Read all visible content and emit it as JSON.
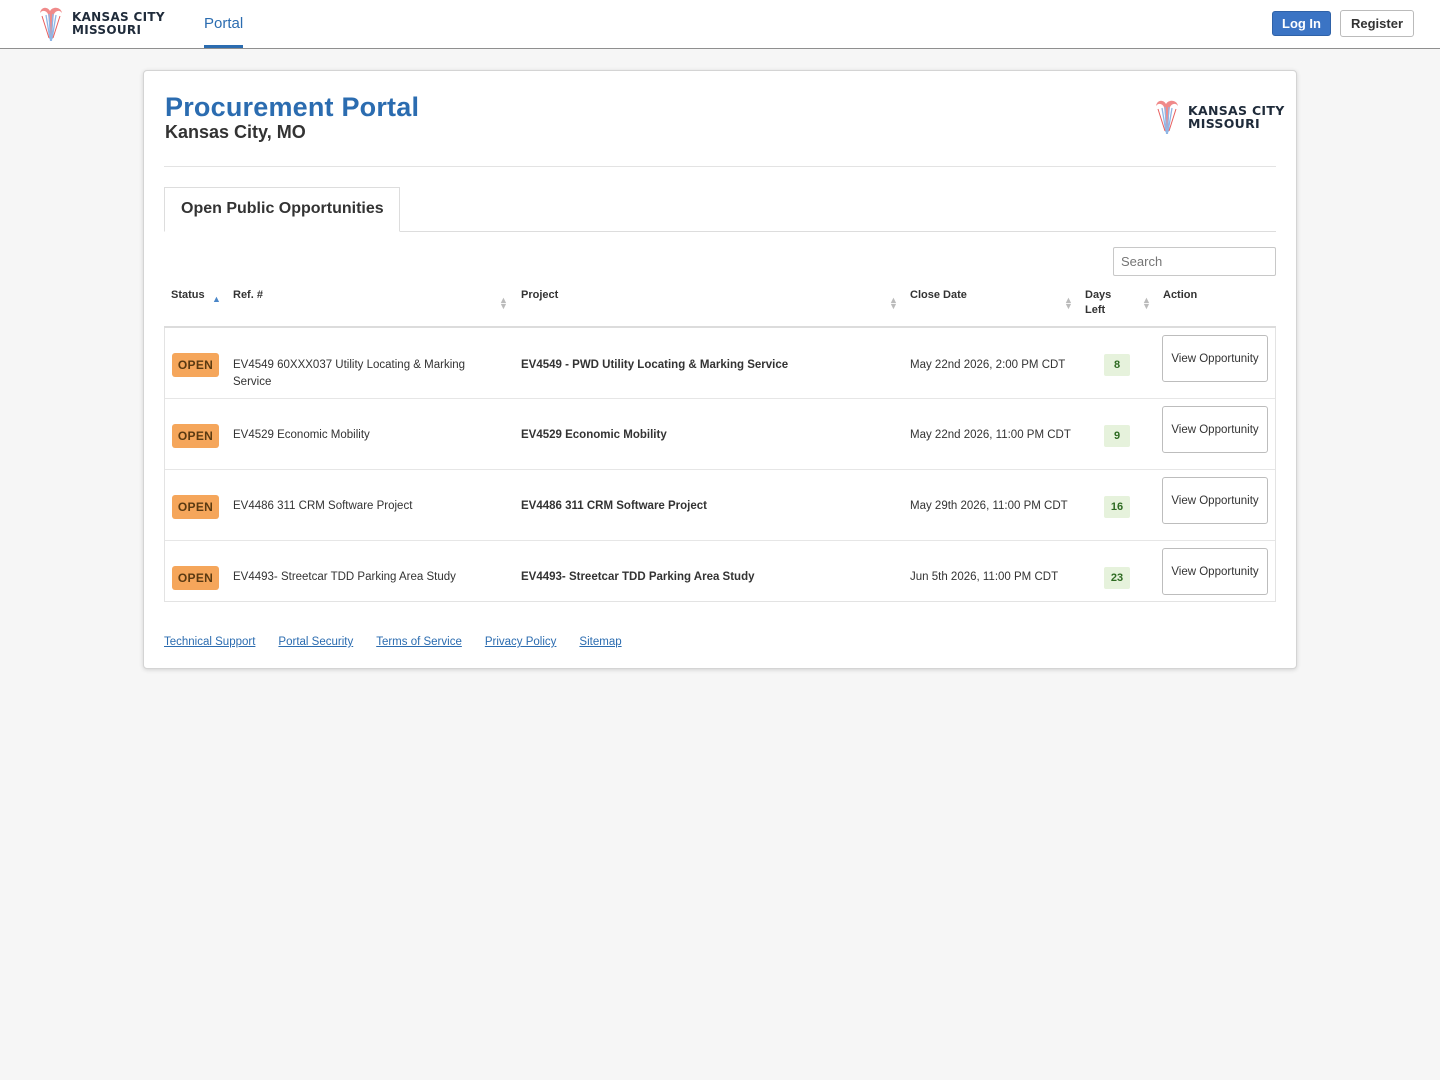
{
  "brand": {
    "line1": "KANSAS CITY",
    "line2": "MISSOURI"
  },
  "nav": {
    "portal_label": "Portal",
    "login_label": "Log In",
    "register_label": "Register"
  },
  "header": {
    "title": "Procurement Portal",
    "subtitle": "Kansas City, MO"
  },
  "tabs": [
    {
      "label": "Open Public Opportunities"
    }
  ],
  "search": {
    "placeholder": "Search"
  },
  "table": {
    "columns": [
      "Status",
      "Ref. #",
      "Project",
      "Close Date",
      "Days Left",
      "Action"
    ],
    "rows": [
      {
        "status": "OPEN",
        "ref": "EV4549 60XXX037 Utility Locating & Marking Service",
        "project": "EV4549 - PWD Utility Locating & Marking Service",
        "close_date": "May 22nd 2026, 2:00 PM CDT",
        "days_left": "8",
        "action": "View Opportunity"
      },
      {
        "status": "OPEN",
        "ref": "EV4529 Economic Mobility",
        "project": "EV4529 Economic Mobility",
        "close_date": "May 22nd 2026, 11:00 PM CDT",
        "days_left": "9",
        "action": "View Opportunity"
      },
      {
        "status": "OPEN",
        "ref": "EV4486 311 CRM Software Project",
        "project": "EV4486 311 CRM Software Project",
        "close_date": "May 29th 2026, 11:00 PM CDT",
        "days_left": "16",
        "action": "View Opportunity"
      },
      {
        "status": "OPEN",
        "ref": "EV4493- Streetcar TDD Parking Area Study",
        "project": "EV4493- Streetcar TDD Parking Area Study",
        "close_date": "Jun 5th 2026, 11:00 PM CDT",
        "days_left": "23",
        "action": "View Opportunity"
      }
    ]
  },
  "footer": {
    "links": [
      "Technical Support",
      "Portal Security",
      "Terms of Service",
      "Privacy Policy",
      "Sitemap"
    ]
  },
  "colors": {
    "primary": "#2b6cb0",
    "button": "#3b74c4",
    "open_badge": "#f5a65b",
    "days_badge": "#e6f2dc"
  },
  "icons": {
    "logo": "kansas-city-fountain-logo",
    "sort": "sort-arrows-icon"
  }
}
